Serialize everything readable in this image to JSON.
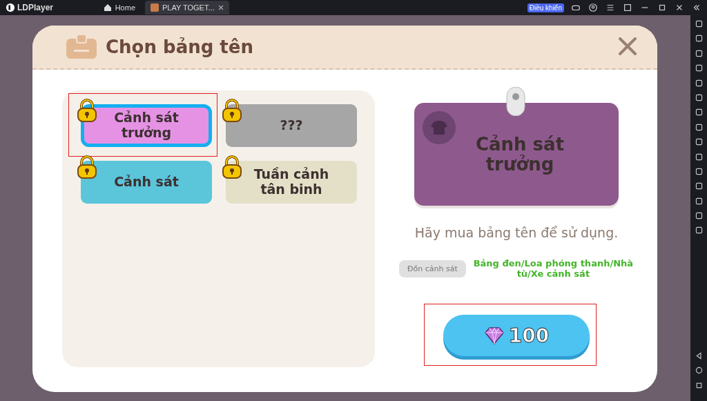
{
  "titlebar": {
    "app_name": "LDPlayer",
    "tabs": [
      {
        "label": "Home",
        "selected": false,
        "closable": false
      },
      {
        "label": "PLAY TOGET...",
        "selected": true,
        "closable": true
      }
    ],
    "control_button": "Điều khiển"
  },
  "dialog": {
    "title": "Chọn bảng tên",
    "tiles": [
      {
        "label": "Cảnh sát trưởng",
        "color": "#e592e5",
        "locked": true,
        "selected": true,
        "highlighted": true
      },
      {
        "label": "???",
        "color": "#a6a6a6",
        "locked": true,
        "selected": false,
        "highlighted": false
      },
      {
        "label": "Cảnh sát",
        "color": "#5bc5da",
        "locked": true,
        "selected": false,
        "highlighted": false
      },
      {
        "label": "Tuần cảnh tân binh",
        "color": "#e4e0c8",
        "locked": true,
        "selected": false,
        "highlighted": false
      }
    ],
    "preview": {
      "label": "Cảnh sát trưởng",
      "color": "#8e5a8e"
    },
    "message": "Hãy mua bảng tên để sử dụng.",
    "requirement_tag": "Đồn cảnh sát",
    "requirement_text": "Bảng đen/Loa phóng thanh/Nhà tù/Xe cảnh sát",
    "buy_button": {
      "price": "100",
      "highlighted": true
    }
  }
}
